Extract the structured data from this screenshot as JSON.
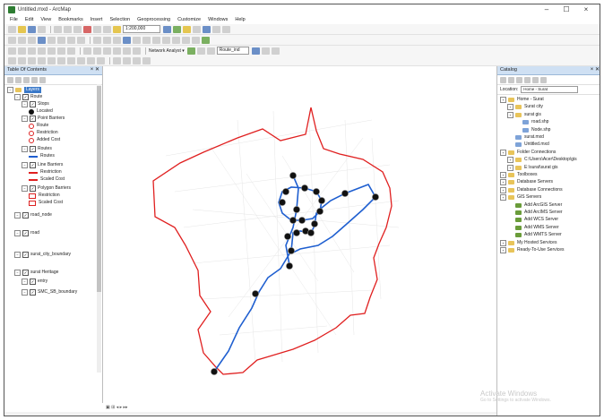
{
  "window": {
    "title": "Untitled.mxd - ArcMap",
    "minimize": "–",
    "maximize": "☐",
    "close": "×"
  },
  "menus": [
    "File",
    "Edit",
    "View",
    "Bookmarks",
    "Insert",
    "Selection",
    "Geoprocessing",
    "Customize",
    "Windows",
    "Help"
  ],
  "toolbar": {
    "scale": "1:200,000",
    "network_label": "Network Analyst ▾",
    "network_layer": "Route_ind"
  },
  "toc": {
    "title": "Table Of Contents",
    "items": [
      {
        "label": "Layers",
        "level": 0,
        "type": "group",
        "selected": true
      },
      {
        "label": "Route",
        "level": 1,
        "type": "group"
      },
      {
        "label": "Stops",
        "level": 2,
        "type": "group"
      },
      {
        "label": "Located",
        "level": 3,
        "type": "black-dot"
      },
      {
        "label": "Point Barriers",
        "level": 2,
        "type": "group"
      },
      {
        "label": "Route",
        "level": 3,
        "type": "red-circle"
      },
      {
        "label": "Restriction",
        "level": 3,
        "type": "red-circle"
      },
      {
        "label": "Added Cost",
        "level": 3,
        "type": "red-circle"
      },
      {
        "label": "Routes",
        "level": 2,
        "type": "group"
      },
      {
        "label": "Routes",
        "level": 3,
        "type": "blue-line"
      },
      {
        "label": "Line Barriers",
        "level": 2,
        "type": "group"
      },
      {
        "label": "Restriction",
        "level": 3,
        "type": "red-line"
      },
      {
        "label": "Scaled Cost",
        "level": 3,
        "type": "red-line"
      },
      {
        "label": "Polygon Barriers",
        "level": 2,
        "type": "group"
      },
      {
        "label": "Restriction",
        "level": 3,
        "type": "red-poly"
      },
      {
        "label": "Scaled Cost",
        "level": 3,
        "type": "red-poly"
      },
      {
        "label": "road_node",
        "level": 1,
        "type": "layer"
      },
      {
        "label": "road",
        "level": 1,
        "type": "layer"
      },
      {
        "label": "surat_city_boundary",
        "level": 1,
        "type": "layer"
      },
      {
        "label": "surat Heritage",
        "level": 1,
        "type": "layer"
      },
      {
        "label": "entry",
        "level": 2,
        "type": "layer"
      },
      {
        "label": "SMC_SB_boundary",
        "level": 2,
        "type": "layer"
      }
    ]
  },
  "catalog": {
    "title": "Catalog",
    "location_label": "Location:",
    "location_value": "Home - Surat",
    "items": [
      {
        "label": "Home - Surat",
        "level": 0,
        "type": "folder"
      },
      {
        "label": "Surat city",
        "level": 1,
        "type": "folder"
      },
      {
        "label": "surat gis",
        "level": 1,
        "type": "folder"
      },
      {
        "label": "road.shp",
        "level": 2,
        "type": "file"
      },
      {
        "label": "Node.shp",
        "level": 2,
        "type": "file"
      },
      {
        "label": "surat.mxd",
        "level": 1,
        "type": "file"
      },
      {
        "label": "Untitled.mxd",
        "level": 1,
        "type": "file"
      },
      {
        "label": "Folder Connections",
        "level": 0,
        "type": "folder"
      },
      {
        "label": "C:\\Users\\Acer\\Desktop\\gis",
        "level": 1,
        "type": "folder"
      },
      {
        "label": "E:\\surat\\surat gis",
        "level": 1,
        "type": "folder"
      },
      {
        "label": "Toolboxes",
        "level": 0,
        "type": "folder"
      },
      {
        "label": "Database Servers",
        "level": 0,
        "type": "folder"
      },
      {
        "label": "Database Connections",
        "level": 0,
        "type": "folder"
      },
      {
        "label": "GIS Servers",
        "level": 0,
        "type": "folder"
      },
      {
        "label": "Add ArcGIS Server",
        "level": 1,
        "type": "server"
      },
      {
        "label": "Add ArcIMS Server",
        "level": 1,
        "type": "server"
      },
      {
        "label": "Add WCS Server",
        "level": 1,
        "type": "server"
      },
      {
        "label": "Add WMS Server",
        "level": 1,
        "type": "server"
      },
      {
        "label": "Add WMTS Server",
        "level": 1,
        "type": "server"
      },
      {
        "label": "My Hosted Services",
        "level": 0,
        "type": "folder"
      },
      {
        "label": "Ready-To-Use Services",
        "level": 0,
        "type": "folder"
      }
    ]
  },
  "watermark": {
    "line1": "Activate Windows",
    "line2": "Go to Settings to activate Windows."
  },
  "status": "▣ ⊞ ◂ ▸ ▸▸",
  "colors": {
    "boundary": "#e02020",
    "route": "#1f5fd0",
    "stop": "#111111",
    "panel_header": "#cfe0f3"
  }
}
